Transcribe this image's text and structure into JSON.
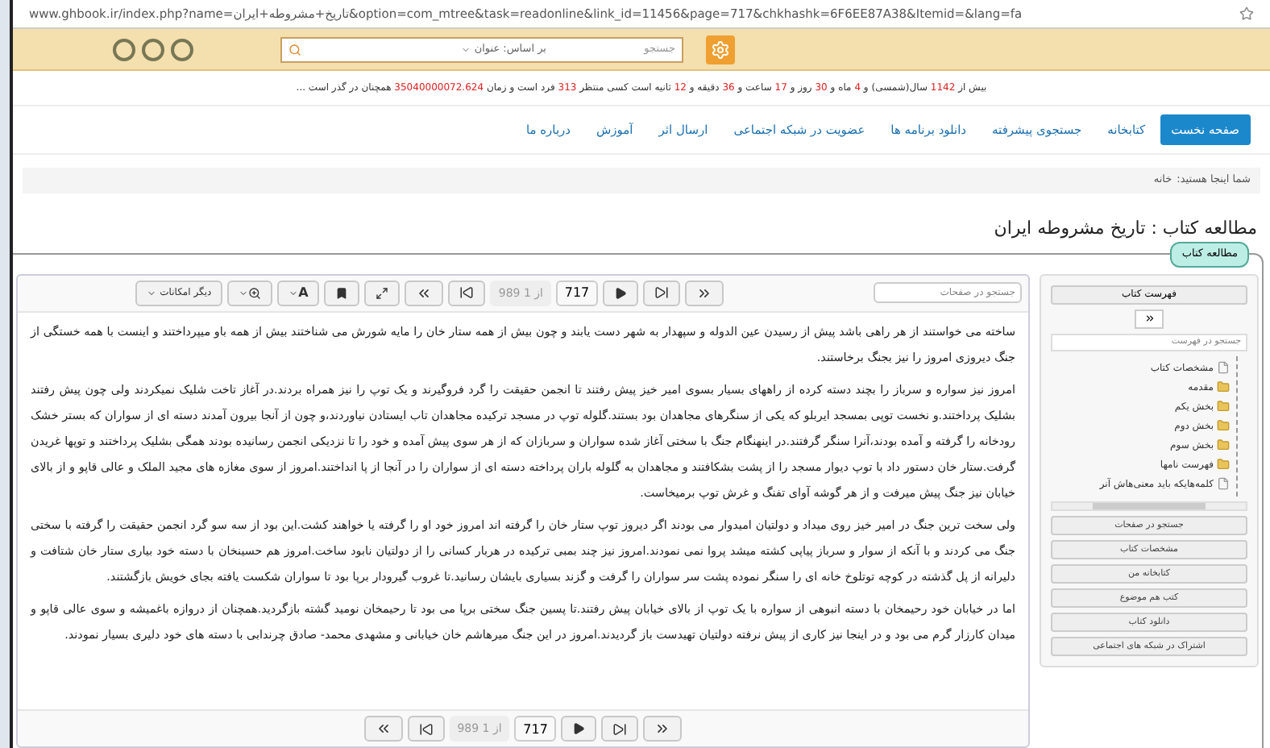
{
  "address_bar": {
    "url": "www.ghbook.ir/index.php?name=تاریخ+مشروطه+ایران&option=com_mtree&task=readonline&link_id=11456&page=717&chkhashk=6F6EE87A38&Itemid=&lang=fa"
  },
  "header": {
    "search_placeholder": "جستجو",
    "search_by": "بر اساس: عنوان"
  },
  "info_line": [
    {
      "text": "بیش از ",
      "highlight": false
    },
    {
      "text": "1142",
      "highlight": true
    },
    {
      "text": " سال(شمسی) و ",
      "highlight": false
    },
    {
      "text": "4",
      "highlight": true
    },
    {
      "text": " ماه و ",
      "highlight": false
    },
    {
      "text": "30",
      "highlight": true
    },
    {
      "text": " روز و ",
      "highlight": false
    },
    {
      "text": "17",
      "highlight": true
    },
    {
      "text": " ساعت و ",
      "highlight": false
    },
    {
      "text": "36",
      "highlight": true
    },
    {
      "text": " دقیقه و ",
      "highlight": false
    },
    {
      "text": "12",
      "highlight": true
    },
    {
      "text": " ثانیه است کسی منتظر ",
      "highlight": false
    },
    {
      "text": "313",
      "highlight": true
    },
    {
      "text": " فرد است و زمان ",
      "highlight": false
    },
    {
      "text": "35040000072.624",
      "highlight": true
    },
    {
      "text": " همچنان در گذر است ...",
      "highlight": false
    }
  ],
  "nav": [
    {
      "label": "صفحه نخست",
      "selected": true
    },
    {
      "label": "کتابخانه",
      "selected": false
    },
    {
      "label": "جستجوی پیشرفته",
      "selected": false
    },
    {
      "label": "دانلود برنامه ها",
      "selected": false
    },
    {
      "label": "عضویت در شبکه اجتماعی",
      "selected": false
    },
    {
      "label": "ارسال اثر",
      "selected": false
    },
    {
      "label": "آموزش",
      "selected": false
    },
    {
      "label": "درباره ما",
      "selected": false
    }
  ],
  "breadcrumb": {
    "label": "شما اینجا هستید:",
    "home": "خانه"
  },
  "page_title": "مطالعه کتاب : تاریخ مشروطه ایران",
  "panel_tab": "مطالعه کتاب",
  "toolbar": {
    "font_button": "A",
    "more": "دیگر امکانات",
    "page_count": "989 از 1",
    "page": "717",
    "search_placeholder": "جستجو در صفحات"
  },
  "paragraphs": [
    "ساخته می خواستند از هر راهی باشد پیش از رسیدن عین الدوله و سپهدار به شهر دست یابند و چون بیش از همه ستار خان را مایه شورش می شناختند بیش از همه باو میپرداختند و اینست با همه خستگی از جنگ دیروزی امروز را نیز بجنگ برخاستند.",
    "امروز نیز سواره و سرباز را بچند دسته کرده از راههای بسیار بسوی امیر خیز پیش رفتند تا انجمن حقیقت را گرد فروگیرند و یک توپ را نیز همراه بردند.در آغاز تاخت شلیک نمیکردند ولی چون پیش رفتند بشلیک پرداختند.و نخست توپی بمسجد ایربلو که یکی از سنگرهای مجاهدان بود بستند.گلوله توپ در مسجد ترکیده مجاهدان تاب ایستادن نیاوردند،و چون از آنجا بیرون آمدند دسته ای از سواران که بستر خشک رودخانه را گرفته و آمده بودند،آنرا سنگر گرفتند.در اینهنگام جنگ با سختی آغاز شده سواران و سربازان که از هر سوی پیش آمده و خود را تا نزدیکی انجمن رسانیده بودند همگی بشلیک پرداختند و توپها غریدن گرفت.ستار خان دستور داد با توپ دیوار مسجد را از پشت بشکافتند و مجاهدان به گلوله باران پرداخته دسته ای از سواران را در آنجا از پا انداختند.امروز از سوی مغازه های مجید الملک و عالی قاپو و از بالای خیابان نیز جنگ پیش میرفت و از هر گوشه آوای تفنگ و غرش توپ برمیخاست.",
    "ولی سخت ترین جنگ در امیر خیز روی میداد و دولتیان امیدوار می بودند اگر دیروز توپ ستار خان را گرفته اند امروز خود او را گرفته یا خواهند کشت.این بود از سه سو گرد انجمن حقیقت را گرفته با سختی جنگ می کردند و با آنکه از سوار و سرباز پیاپی کشته میشد پروا نمی نمودند.امروز نیز چند بمبی ترکیده در هربار کسانی را از دولتیان نابود ساخت.امروز هم حسینخان با دسته خود بیاری ستار خان شتافت و دلیرانه از پل گذشته در کوچه توتلوخ خانه ای را سنگر نموده پشت سر سواران را گرفت و گزند بسیاری بایشان رسانید.تا غروب گیرودار برپا بود تا سواران شکست یافته بجای خویش بازگشتند.",
    "اما در خیابان خود رحیمخان با دسته انبوهی از سواره با یک توپ از بالای خیابان پیش رفتند.تا پسین جنگ سختی برپا می بود تا رحیمخان نومید گشته بازگردید.همچنان از دروازه باغمیشه و سوی عالی قاپو و میدان کارزار گرم می بود و در اینجا نیز کاری از پیش نرفته دولتیان تهیدست باز گردیدند.امروز در این جنگ میرهاشم خان خیابانی و مشهدی محمد- صادق چرندابی با دسته های خود دلیری بسیار نمودند."
  ],
  "pager": {
    "page_count": "989 از 1",
    "page": "717"
  },
  "sidebar": {
    "header": "فهرست کتاب",
    "search_placeholder": "جستجو در فهرست",
    "tree": [
      {
        "label": "مشخصات کتاب",
        "kind": "file"
      },
      {
        "label": "مقدمه",
        "kind": "folder"
      },
      {
        "label": "بخش یکم",
        "kind": "folder"
      },
      {
        "label": "بخش دوم",
        "kind": "folder"
      },
      {
        "label": "بخش سوم",
        "kind": "folder"
      },
      {
        "label": "فهرست نامها",
        "kind": "folder"
      },
      {
        "label": "کلمه‌هایکه باید معنی‌هاش آنر",
        "kind": "file"
      }
    ],
    "buttons": [
      "جستجو در صفحات",
      "مشخصات کتاب",
      "کتابخانه من",
      "کتب هم موضوع",
      "دانلود کتاب",
      "اشتراک در شبکه های اجتماعی"
    ]
  }
}
